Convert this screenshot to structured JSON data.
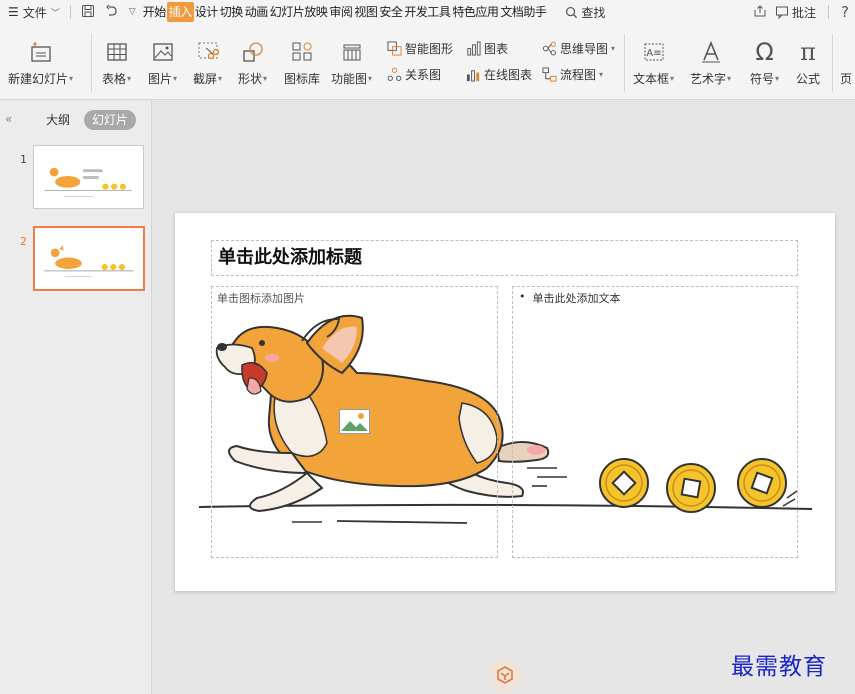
{
  "menubar": {
    "file_label": "文件",
    "tabs": [
      "开始",
      "插入",
      "设计",
      "切换",
      "动画",
      "幻灯片放映",
      "审阅",
      "视图",
      "安全",
      "开发工具",
      "特色应用",
      "文档助手"
    ],
    "search_label": "查找",
    "comment_label": "批注",
    "help_label": "?"
  },
  "ribbon": {
    "new_slide": "新建幻灯片",
    "table": "表格",
    "picture": "图片",
    "screenshot": "截屏",
    "shape": "形状",
    "icon_lib": "图标库",
    "function_chart": "功能图",
    "smart_shape": "智能图形",
    "chart": "图表",
    "mind_map": "思维导图",
    "relation": "关系图",
    "online_chart": "在线图表",
    "flowchart": "流程图",
    "textbox": "文本框",
    "wordart": "艺术字",
    "symbol": "符号",
    "formula": "公式",
    "page_partial": "页"
  },
  "pane": {
    "outline_tab": "大纲",
    "slides_tab": "幻灯片",
    "slide_numbers": [
      "1",
      "2"
    ]
  },
  "slide": {
    "title_placeholder": "单击此处添加标题",
    "picture_placeholder": "单击图标添加图片",
    "text_placeholder": "单击此处添加文本",
    "bullet": "•"
  },
  "watermark": "最需教育",
  "colors": {
    "accent": "#f19a3e",
    "selected_thumb": "#f07b45",
    "watermark": "#1a24c8",
    "dog_orange": "#f2a33a",
    "coin_gold": "#f5c42c"
  }
}
